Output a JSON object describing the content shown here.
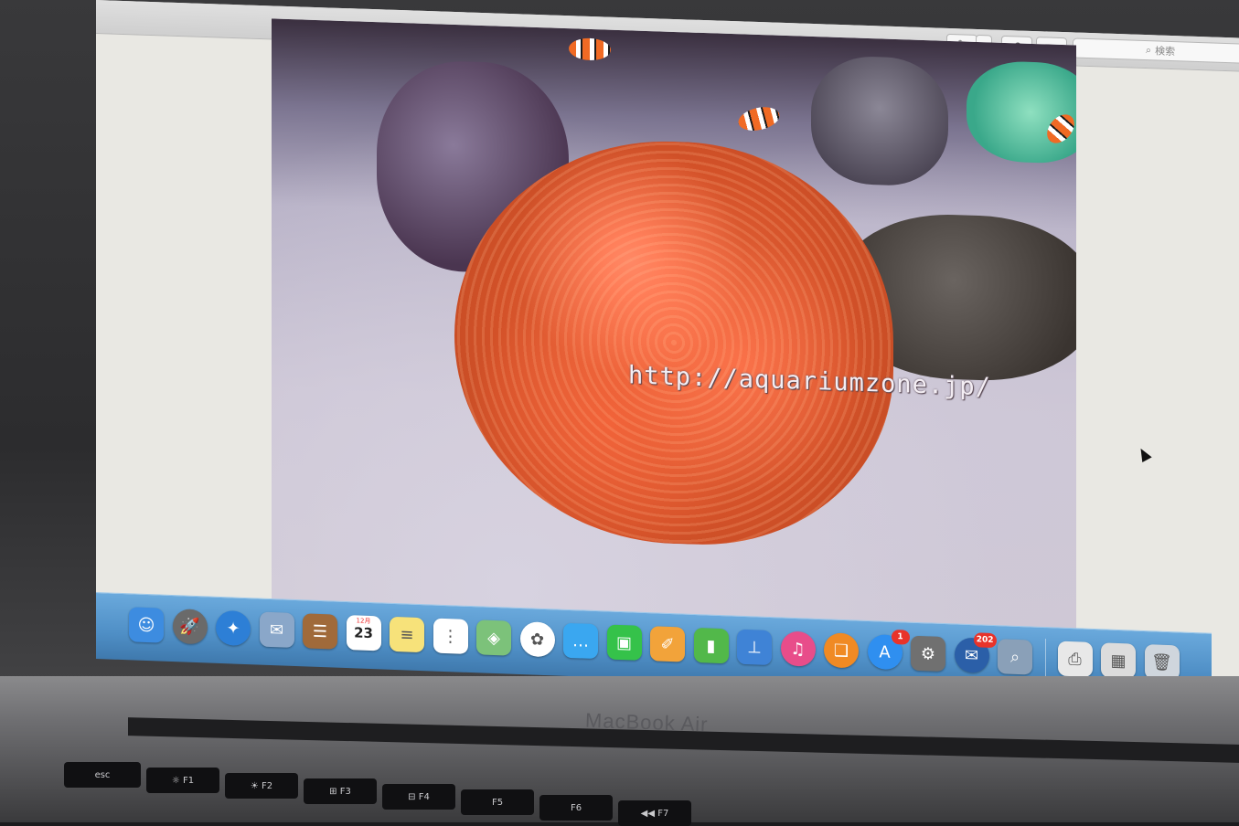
{
  "laptop": {
    "brand": "MacBook Air"
  },
  "toolbar": {
    "markup_label": "✎",
    "markup_dropdown_label": "▾",
    "rotate_label": "⟲",
    "toolbox_label": "⌂",
    "search_placeholder": "検索",
    "search_icon": "magnifier-icon"
  },
  "photo": {
    "watermark": "http://aquariumzone.jp/",
    "colors": {
      "anemone": "#e8704a",
      "sand": "#cbc4d4"
    }
  },
  "dock": {
    "items": [
      {
        "name": "finder",
        "icon": "finder-icon",
        "glyph": "☺",
        "color": "#3d8ce0"
      },
      {
        "name": "launchpad",
        "icon": "rocket-icon",
        "glyph": "🚀",
        "color": "#6a6a6a"
      },
      {
        "name": "safari",
        "icon": "compass-icon",
        "glyph": "✦",
        "color": "#2d7fd6"
      },
      {
        "name": "mail",
        "icon": "stamp-icon",
        "glyph": "✉",
        "color": "#8aa7c9"
      },
      {
        "name": "contacts",
        "icon": "address-book-icon",
        "glyph": "☰",
        "color": "#a06a3a"
      },
      {
        "name": "calendar",
        "icon": "calendar-icon",
        "month": "12月",
        "day": "23",
        "color": "#ffffff"
      },
      {
        "name": "notes",
        "icon": "notepad-icon",
        "glyph": "≡",
        "color": "#f7e27a"
      },
      {
        "name": "reminders",
        "icon": "checklist-icon",
        "glyph": "⋮",
        "color": "#ffffff"
      },
      {
        "name": "maps",
        "icon": "map-icon",
        "glyph": "◈",
        "color": "#7cc27a"
      },
      {
        "name": "photos",
        "icon": "photos-icon",
        "glyph": "✿",
        "color": "#ffffff"
      },
      {
        "name": "messages",
        "icon": "speech-bubble-icon",
        "glyph": "…",
        "color": "#3aa7f0"
      },
      {
        "name": "facetime",
        "icon": "video-camera-icon",
        "glyph": "▣",
        "color": "#35c24a"
      },
      {
        "name": "pages",
        "icon": "pen-document-icon",
        "glyph": "✐",
        "color": "#f2a33a"
      },
      {
        "name": "numbers",
        "icon": "bar-chart-icon",
        "glyph": "▮",
        "color": "#52b84a"
      },
      {
        "name": "keynote",
        "icon": "podium-icon",
        "glyph": "⊥",
        "color": "#3f83d6"
      },
      {
        "name": "itunes",
        "icon": "music-note-icon",
        "glyph": "♫",
        "color": "#e84d8a"
      },
      {
        "name": "ibooks",
        "icon": "book-icon",
        "glyph": "❑",
        "color": "#f08a24"
      },
      {
        "name": "app-store",
        "icon": "app-store-icon",
        "glyph": "A",
        "color": "#2f8ff0",
        "badge": "1"
      },
      {
        "name": "system-preferences",
        "icon": "gear-icon",
        "glyph": "⚙",
        "color": "#707070"
      },
      {
        "name": "thunderbird",
        "icon": "mail-bird-icon",
        "glyph": "✉",
        "color": "#2b5fa8",
        "badge": "202"
      },
      {
        "name": "preview",
        "icon": "preview-icon",
        "glyph": "⌕",
        "color": "#8aa0b8"
      },
      {
        "name": "printer",
        "icon": "printer-icon",
        "glyph": "⎙",
        "color": "#e8e8e8"
      },
      {
        "name": "downloads-stack",
        "icon": "stack-icon",
        "glyph": "▦",
        "color": "#dcdcdc"
      },
      {
        "name": "trash",
        "icon": "trash-icon",
        "glyph": "🗑",
        "color": "#cfd6dd"
      }
    ]
  }
}
